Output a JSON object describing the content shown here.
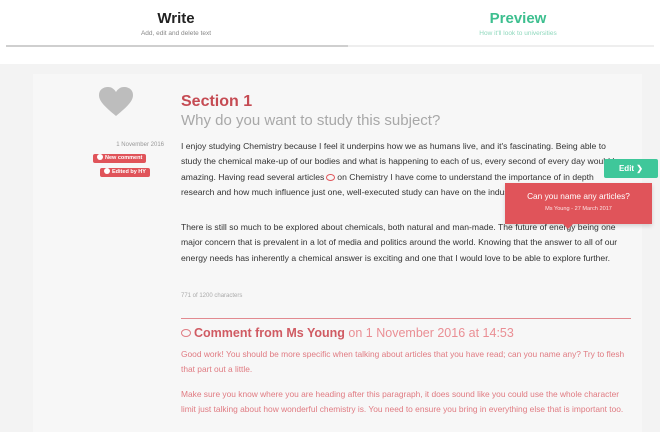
{
  "tabs": {
    "write": {
      "title": "Write",
      "subtitle": "Add, edit and delete text"
    },
    "preview": {
      "title": "Preview",
      "subtitle": "How it'll look to universities"
    }
  },
  "sidebar": {
    "date": "1 November 2016",
    "badges": {
      "new_comment": "New comment",
      "edited_by": "Edited by HY"
    }
  },
  "section": {
    "title": "Section 1",
    "question": "Why do you want to study this subject?",
    "paragraph1_a": "I enjoy studying Chemistry because I feel it underpins how we as humans live, and it's fascinating. Being able to study the chemical make-up of our bodies and what is happening to each of us, every second of every day would be amazing. Having read several articles",
    "paragraph1_b": "on Chemistry I have come to understand the importance of in depth research and how much influence just one, well-executed study can have on the industry.",
    "paragraph2": "There is still so much to be explored about chemicals, both natural and man-made. The future of energy being one major concern that is prevalent in a lot of media and politics around the world. Knowing that the answer to all of our energy needs has inherently a chemical answer is exciting and one that I would love to be able to explore further.",
    "char_count": "771 of 1200 characters"
  },
  "comment": {
    "author": "Comment from Ms Young",
    "date": "on 1 November 2016 at 14:53",
    "text1": "Good work! You should be more specific when talking about articles that you have read; can you name any? Try to flesh that part out a little.",
    "text2": "Make sure you know where you are heading after this paragraph, it does sound like you could use the whole character limit just talking about how wonderful chemistry is. You need to ensure you bring in everything else that is important too."
  },
  "edit_button": {
    "label": "Edit ❯"
  },
  "tooltip": {
    "title": "Can you name any articles?",
    "meta": "Ms Young - 27 March 2017"
  },
  "colors": {
    "accent_green": "#3fc79a",
    "accent_red": "#e0545a",
    "section_title": "#c54b53"
  }
}
